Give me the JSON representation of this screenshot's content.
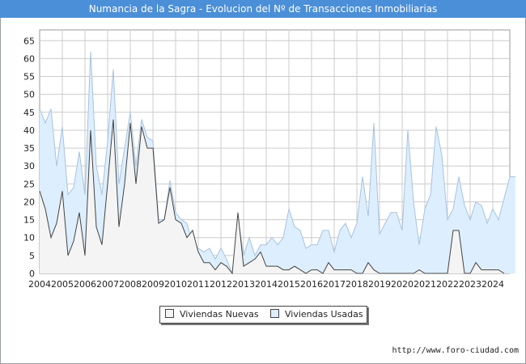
{
  "header": {
    "title": "Numancia de la Sagra - Evolucion del Nº de Transacciones Inmobiliarias"
  },
  "footer": {
    "source": "http://www.foro-ciudad.com"
  },
  "colors": {
    "title_bg": "#4b8fd8",
    "usadas_fill": "#ddeeff",
    "usadas_line": "#a8c3de",
    "nuevas_fill": "#f4f4f4",
    "nuevas_line": "#444444",
    "grid": "#cccccc"
  },
  "chart_data": {
    "type": "area",
    "title": "Numancia de la Sagra - Evolucion del Nº de Transacciones Inmobiliarias",
    "xlabel": "",
    "ylabel": "",
    "x_range": [
      2004,
      2024.75
    ],
    "ylim": [
      0,
      68
    ],
    "y_ticks": [
      0,
      5,
      10,
      15,
      20,
      25,
      30,
      35,
      40,
      45,
      50,
      55,
      60,
      65
    ],
    "x_ticks": [
      "2004",
      "2005",
      "2006",
      "2007",
      "2008",
      "2009",
      "2010",
      "2011",
      "2012",
      "2013",
      "2014",
      "2015",
      "2016",
      "2017",
      "2018",
      "2019",
      "2020",
      "2021",
      "2022",
      "2023",
      "2024"
    ],
    "grid": true,
    "legend": "bottom-center",
    "x_step": "quarter",
    "x_start": "2004 Q1",
    "series": [
      {
        "name": "Viviendas Nuevas",
        "values": [
          23,
          18,
          10,
          14,
          23,
          5,
          9,
          17,
          5,
          40,
          13,
          8,
          25,
          43,
          13,
          25,
          42,
          25,
          41,
          35,
          35,
          14,
          15,
          24,
          15,
          14,
          10,
          12,
          6,
          3,
          3,
          1,
          3,
          2,
          0,
          17,
          2,
          3,
          4,
          6,
          2,
          2,
          2,
          1,
          1,
          2,
          1,
          0,
          1,
          1,
          0,
          3,
          1,
          1,
          1,
          1,
          0,
          0,
          3,
          1,
          0,
          0,
          0,
          0,
          0,
          0,
          0,
          1,
          0,
          0,
          0,
          0,
          0,
          12,
          12,
          0,
          0,
          3,
          1,
          1,
          1,
          1,
          0
        ]
      },
      {
        "name": "Viviendas Usadas",
        "values": [
          46,
          42,
          46,
          30,
          41,
          22,
          24,
          34,
          22,
          62,
          30,
          22,
          37,
          57,
          25,
          35,
          45,
          30,
          43,
          38,
          37,
          15,
          15,
          26,
          17,
          15,
          14,
          8,
          7,
          6,
          7,
          4,
          7,
          4,
          0,
          16,
          5,
          10,
          5,
          8,
          8,
          10,
          8,
          10,
          18,
          13,
          12,
          7,
          8,
          8,
          12,
          12,
          6,
          12,
          14,
          10,
          14,
          27,
          16,
          42,
          11,
          14,
          17,
          17,
          12,
          40,
          20,
          8,
          18,
          22,
          41,
          33,
          15,
          18,
          27,
          19,
          15,
          20,
          19,
          14,
          18,
          15,
          21,
          27,
          27
        ]
      }
    ]
  }
}
